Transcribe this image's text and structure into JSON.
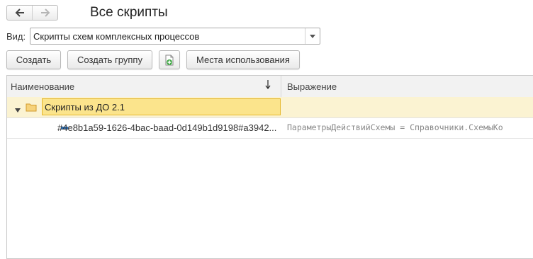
{
  "nav": {
    "back_icon": "arrow-left-icon",
    "forward_icon": "arrow-right-icon"
  },
  "page": {
    "title": "Все скрипты"
  },
  "view": {
    "label": "Вид:",
    "value": "Скрипты схем комплексных процессов"
  },
  "toolbar": {
    "create_label": "Создать",
    "create_group_label": "Создать группу",
    "copy_icon": "add-document-icon",
    "usage_label": "Места использования"
  },
  "table": {
    "columns": [
      "Наименование",
      "Выражение"
    ],
    "sort_indicator": "↓",
    "rows": [
      {
        "type": "group",
        "name": "Скрипты из ДО 2.1",
        "expression": ""
      },
      {
        "type": "item",
        "name": "#4e8b1a59-1626-4bac-baad-0d149b1d9198#a3942...",
        "expression": "ПараметрыДействийСхемы = Справочники.СхемыКо"
      }
    ]
  },
  "colors": {
    "selection": "#fbe48c",
    "selection_border": "#e6b82e",
    "group_row": "#fbf3d2",
    "folder": "#e8b84a",
    "item_icon": "#2d6fb3"
  }
}
